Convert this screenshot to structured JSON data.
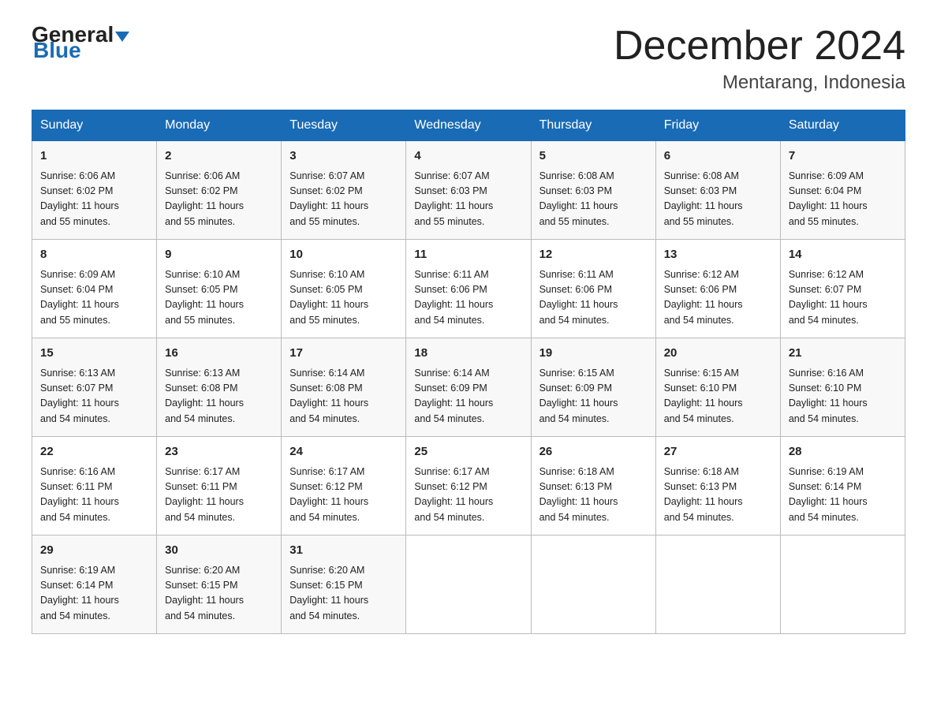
{
  "logo": {
    "general": "General",
    "blue": "Blue"
  },
  "title": {
    "month_year": "December 2024",
    "location": "Mentarang, Indonesia"
  },
  "days_of_week": [
    "Sunday",
    "Monday",
    "Tuesday",
    "Wednesday",
    "Thursday",
    "Friday",
    "Saturday"
  ],
  "weeks": [
    [
      {
        "day": "1",
        "sunrise": "6:06 AM",
        "sunset": "6:02 PM",
        "daylight": "11 hours and 55 minutes."
      },
      {
        "day": "2",
        "sunrise": "6:06 AM",
        "sunset": "6:02 PM",
        "daylight": "11 hours and 55 minutes."
      },
      {
        "day": "3",
        "sunrise": "6:07 AM",
        "sunset": "6:02 PM",
        "daylight": "11 hours and 55 minutes."
      },
      {
        "day": "4",
        "sunrise": "6:07 AM",
        "sunset": "6:03 PM",
        "daylight": "11 hours and 55 minutes."
      },
      {
        "day": "5",
        "sunrise": "6:08 AM",
        "sunset": "6:03 PM",
        "daylight": "11 hours and 55 minutes."
      },
      {
        "day": "6",
        "sunrise": "6:08 AM",
        "sunset": "6:03 PM",
        "daylight": "11 hours and 55 minutes."
      },
      {
        "day": "7",
        "sunrise": "6:09 AM",
        "sunset": "6:04 PM",
        "daylight": "11 hours and 55 minutes."
      }
    ],
    [
      {
        "day": "8",
        "sunrise": "6:09 AM",
        "sunset": "6:04 PM",
        "daylight": "11 hours and 55 minutes."
      },
      {
        "day": "9",
        "sunrise": "6:10 AM",
        "sunset": "6:05 PM",
        "daylight": "11 hours and 55 minutes."
      },
      {
        "day": "10",
        "sunrise": "6:10 AM",
        "sunset": "6:05 PM",
        "daylight": "11 hours and 55 minutes."
      },
      {
        "day": "11",
        "sunrise": "6:11 AM",
        "sunset": "6:06 PM",
        "daylight": "11 hours and 54 minutes."
      },
      {
        "day": "12",
        "sunrise": "6:11 AM",
        "sunset": "6:06 PM",
        "daylight": "11 hours and 54 minutes."
      },
      {
        "day": "13",
        "sunrise": "6:12 AM",
        "sunset": "6:06 PM",
        "daylight": "11 hours and 54 minutes."
      },
      {
        "day": "14",
        "sunrise": "6:12 AM",
        "sunset": "6:07 PM",
        "daylight": "11 hours and 54 minutes."
      }
    ],
    [
      {
        "day": "15",
        "sunrise": "6:13 AM",
        "sunset": "6:07 PM",
        "daylight": "11 hours and 54 minutes."
      },
      {
        "day": "16",
        "sunrise": "6:13 AM",
        "sunset": "6:08 PM",
        "daylight": "11 hours and 54 minutes."
      },
      {
        "day": "17",
        "sunrise": "6:14 AM",
        "sunset": "6:08 PM",
        "daylight": "11 hours and 54 minutes."
      },
      {
        "day": "18",
        "sunrise": "6:14 AM",
        "sunset": "6:09 PM",
        "daylight": "11 hours and 54 minutes."
      },
      {
        "day": "19",
        "sunrise": "6:15 AM",
        "sunset": "6:09 PM",
        "daylight": "11 hours and 54 minutes."
      },
      {
        "day": "20",
        "sunrise": "6:15 AM",
        "sunset": "6:10 PM",
        "daylight": "11 hours and 54 minutes."
      },
      {
        "day": "21",
        "sunrise": "6:16 AM",
        "sunset": "6:10 PM",
        "daylight": "11 hours and 54 minutes."
      }
    ],
    [
      {
        "day": "22",
        "sunrise": "6:16 AM",
        "sunset": "6:11 PM",
        "daylight": "11 hours and 54 minutes."
      },
      {
        "day": "23",
        "sunrise": "6:17 AM",
        "sunset": "6:11 PM",
        "daylight": "11 hours and 54 minutes."
      },
      {
        "day": "24",
        "sunrise": "6:17 AM",
        "sunset": "6:12 PM",
        "daylight": "11 hours and 54 minutes."
      },
      {
        "day": "25",
        "sunrise": "6:17 AM",
        "sunset": "6:12 PM",
        "daylight": "11 hours and 54 minutes."
      },
      {
        "day": "26",
        "sunrise": "6:18 AM",
        "sunset": "6:13 PM",
        "daylight": "11 hours and 54 minutes."
      },
      {
        "day": "27",
        "sunrise": "6:18 AM",
        "sunset": "6:13 PM",
        "daylight": "11 hours and 54 minutes."
      },
      {
        "day": "28",
        "sunrise": "6:19 AM",
        "sunset": "6:14 PM",
        "daylight": "11 hours and 54 minutes."
      }
    ],
    [
      {
        "day": "29",
        "sunrise": "6:19 AM",
        "sunset": "6:14 PM",
        "daylight": "11 hours and 54 minutes."
      },
      {
        "day": "30",
        "sunrise": "6:20 AM",
        "sunset": "6:15 PM",
        "daylight": "11 hours and 54 minutes."
      },
      {
        "day": "31",
        "sunrise": "6:20 AM",
        "sunset": "6:15 PM",
        "daylight": "11 hours and 54 minutes."
      },
      null,
      null,
      null,
      null
    ]
  ],
  "labels": {
    "sunrise": "Sunrise:",
    "sunset": "Sunset:",
    "daylight": "Daylight:"
  },
  "colors": {
    "header_bg": "#1a6bb5",
    "header_text": "#ffffff",
    "accent_blue": "#1a6bb5"
  }
}
